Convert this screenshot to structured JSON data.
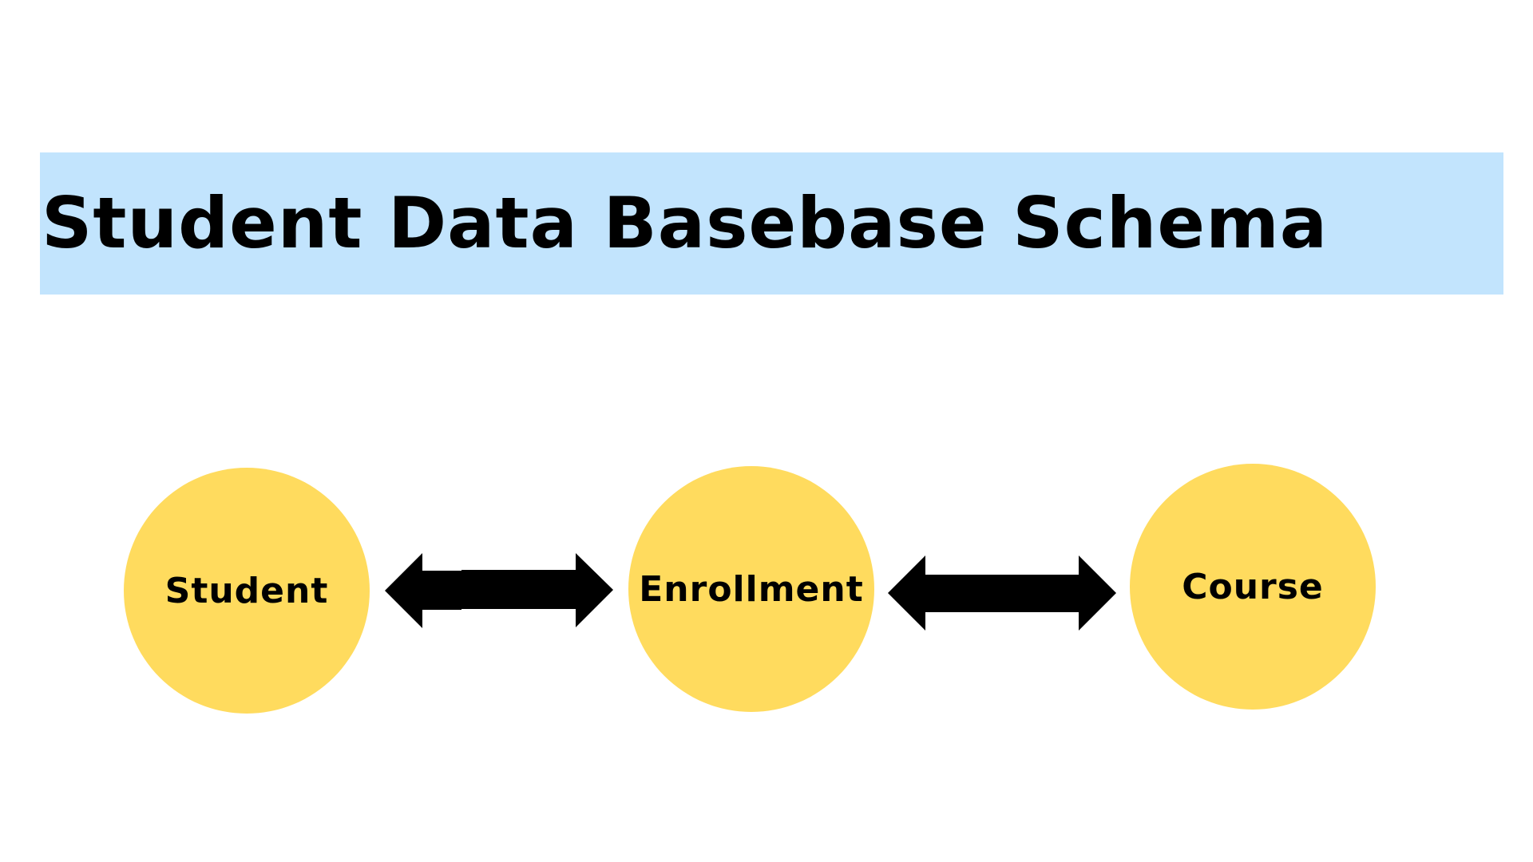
{
  "title": "Student Data Basebase Schema",
  "nodes": [
    {
      "label": "Student"
    },
    {
      "label": "Enrollment"
    },
    {
      "label": "Course"
    }
  ],
  "connections": [
    {
      "from": "Student",
      "to": "Enrollment",
      "style": "double-headed-arrow"
    },
    {
      "from": "Enrollment",
      "to": "Course",
      "style": "double-headed-arrow"
    }
  ],
  "colors": {
    "title_band": "#c2e4fd",
    "node_fill": "#ffdb5e",
    "arrow": "#000000",
    "text": "#000000",
    "background": "#ffffff"
  }
}
